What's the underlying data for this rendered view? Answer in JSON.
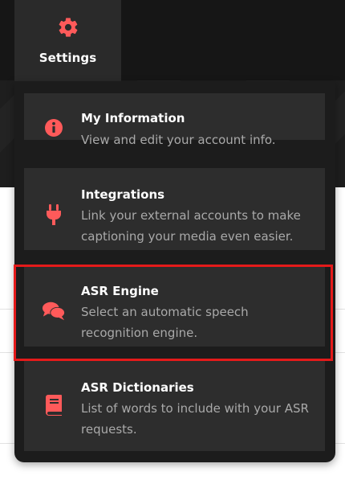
{
  "settings_tab": {
    "label": "Settings",
    "icon": "gear-icon"
  },
  "menu": {
    "items": [
      {
        "title": "My Information",
        "description": "View and edit your account info.",
        "icon": "info-circle-icon"
      },
      {
        "title": "Integrations",
        "description": "Link your external accounts to make captioning your media even easier.",
        "icon": "plug-icon"
      },
      {
        "title": "ASR Engine",
        "description": "Select an automatic speech recognition engine.",
        "icon": "chat-bubbles-icon",
        "highlighted": true
      },
      {
        "title": "ASR Dictionaries",
        "description": "List of words to include with your ASR requests.",
        "icon": "book-icon"
      }
    ]
  },
  "colors": {
    "accent": "#ff5a5a",
    "highlight_border": "#e41a1a",
    "menu_bg": "#1c1c1c",
    "item_bg": "#2d2d2d",
    "description_text": "#a9a9a9"
  }
}
